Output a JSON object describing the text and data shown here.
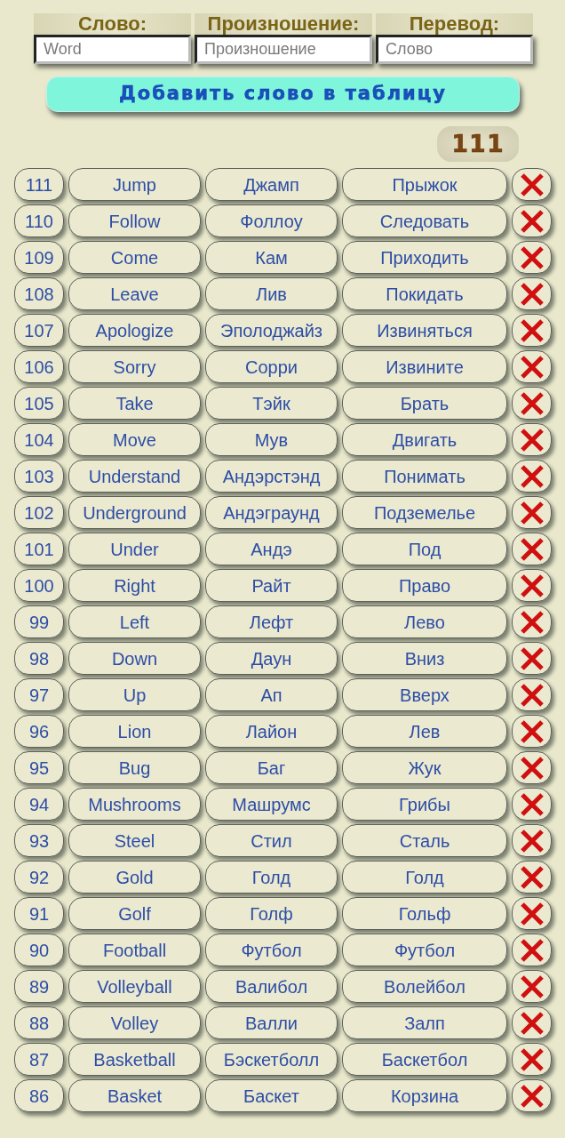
{
  "fields": [
    {
      "label": "Слово:",
      "placeholder": "Word"
    },
    {
      "label": "Произношение:",
      "placeholder": "Произношение"
    },
    {
      "label": "Перевод:",
      "placeholder": "Слово"
    }
  ],
  "add_button": "Добавить слово в таблицу",
  "counter": "111",
  "rows": [
    {
      "number": "111",
      "word": "Jump",
      "pronunciation": "Джамп",
      "translation": "Прыжок"
    },
    {
      "number": "110",
      "word": "Follow",
      "pronunciation": "Фоллоу",
      "translation": "Следовать"
    },
    {
      "number": "109",
      "word": "Come",
      "pronunciation": "Кам",
      "translation": "Приходить"
    },
    {
      "number": "108",
      "word": "Leave",
      "pronunciation": "Лив",
      "translation": "Покидать"
    },
    {
      "number": "107",
      "word": "Apologize",
      "pronunciation": "Эполоджайз",
      "translation": "Извиняться"
    },
    {
      "number": "106",
      "word": "Sorry",
      "pronunciation": "Сорри",
      "translation": "Извините"
    },
    {
      "number": "105",
      "word": "Take",
      "pronunciation": "Тэйк",
      "translation": "Брать"
    },
    {
      "number": "104",
      "word": "Move",
      "pronunciation": "Мув",
      "translation": "Двигать"
    },
    {
      "number": "103",
      "word": "Understand",
      "pronunciation": "Андэрстэнд",
      "translation": "Понимать"
    },
    {
      "number": "102",
      "word": "Underground",
      "pronunciation": "Андэграунд",
      "translation": "Подземелье"
    },
    {
      "number": "101",
      "word": "Under",
      "pronunciation": "Андэ",
      "translation": "Под"
    },
    {
      "number": "100",
      "word": "Right",
      "pronunciation": "Райт",
      "translation": "Право"
    },
    {
      "number": "99",
      "word": "Left",
      "pronunciation": "Лефт",
      "translation": "Лево"
    },
    {
      "number": "98",
      "word": "Down",
      "pronunciation": "Даун",
      "translation": "Вниз"
    },
    {
      "number": "97",
      "word": "Up",
      "pronunciation": "Ап",
      "translation": "Вверх"
    },
    {
      "number": "96",
      "word": "Lion",
      "pronunciation": "Лайон",
      "translation": "Лев"
    },
    {
      "number": "95",
      "word": "Bug",
      "pronunciation": "Баг",
      "translation": "Жук"
    },
    {
      "number": "94",
      "word": "Mushrooms",
      "pronunciation": "Машрумс",
      "translation": "Грибы"
    },
    {
      "number": "93",
      "word": "Steel",
      "pronunciation": "Стил",
      "translation": "Сталь"
    },
    {
      "number": "92",
      "word": "Gold",
      "pronunciation": "Голд",
      "translation": "Голд"
    },
    {
      "number": "91",
      "word": "Golf",
      "pronunciation": "Голф",
      "translation": "Гольф"
    },
    {
      "number": "90",
      "word": "Football",
      "pronunciation": "Футбол",
      "translation": "Футбол"
    },
    {
      "number": "89",
      "word": "Volleyball",
      "pronunciation": "Валибол",
      "translation": "Волейбол"
    },
    {
      "number": "88",
      "word": "Volley",
      "pronunciation": "Валли",
      "translation": "Залп"
    },
    {
      "number": "87",
      "word": "Basketball",
      "pronunciation": "Бэскетболл",
      "translation": "Баскетбол"
    },
    {
      "number": "86",
      "word": "Basket",
      "pronunciation": "Баскет",
      "translation": "Корзина"
    }
  ]
}
